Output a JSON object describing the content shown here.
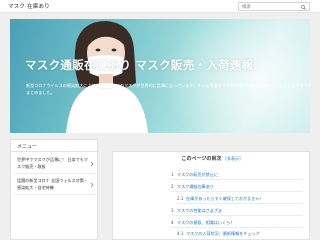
{
  "header": {
    "site_title": "マスク 在庫あり",
    "search_placeholder": "検索"
  },
  "hero": {
    "title": "マスク通販在庫あり マスク販売・入荷速報",
    "description": "新型コロナウイルスの感染拡大により、予防のためのマスクが世界的に品薄になっています。そんな貴重なマスク在庫あり販売通販のさいしんじょうほうをまとめました。"
  },
  "sidebar": {
    "heading": "メニュー",
    "items": [
      {
        "label": "世界中でマスクが品薄に！ 日本でもマスク販売・取扱"
      },
      {
        "label": "話題の新型コロナ 全国ウィルス対策・感染拡大・自宅待機"
      }
    ]
  },
  "toc": {
    "heading": "このページの目次",
    "toggle": "[非表示]",
    "items": [
      {
        "number": "1",
        "label": "マスクの転売が禁止に"
      },
      {
        "number": "2",
        "label": "マスク通販在庫あり"
      },
      {
        "number": "2.1",
        "label": "在庫があったらすぐ確保しておかなきゃ！"
      },
      {
        "number": "3",
        "label": "マスクの性能はさまざま"
      },
      {
        "number": "4",
        "label": "マスクの値段、相場はいくら？"
      },
      {
        "number": "4.1",
        "label": "マスクの入荷状況、最新情報をチェック"
      }
    ]
  }
}
